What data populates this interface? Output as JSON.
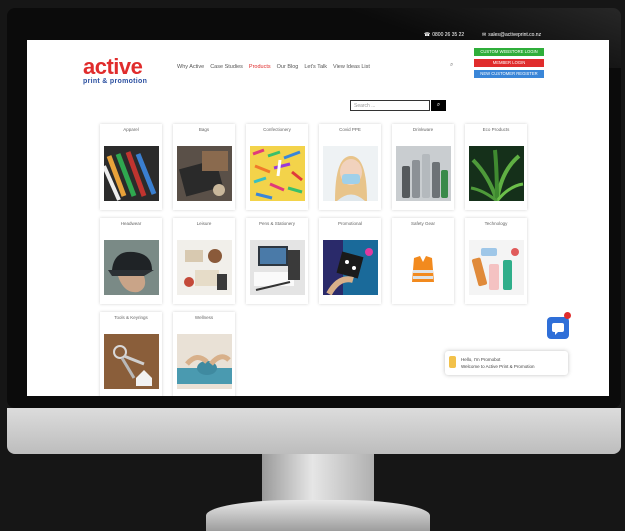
{
  "contact": {
    "phone": "0800 26 35 22",
    "email": "sales@activeprint.co.nz"
  },
  "logo": {
    "word": "active",
    "sub": "print & promotion"
  },
  "nav": [
    "Why Active",
    "Case Studies",
    "Products",
    "Our Blog",
    "Let's Talk",
    "View Ideas List"
  ],
  "nav_active": "Products",
  "buttons": {
    "custom": "CUSTOM WEBSTORE LOGIN",
    "member": "MEMBER LOGIN",
    "new_customer": "NEW CUSTOMER REGISTER"
  },
  "search": {
    "placeholder": "Search ..."
  },
  "categories": [
    "Apparel",
    "Bags",
    "Confectionery",
    "Covid PPE",
    "Drinkware",
    "Eco Products",
    "Headwear",
    "Leisure",
    "Pens & Stationery",
    "Promotional",
    "Safety Gear",
    "Technology",
    "Tools & Keyrings",
    "Wellness"
  ],
  "chat": {
    "line1": "Hello, I'm Promobot",
    "line2": "Welcome to Active Print & Promotion"
  },
  "colors": {
    "brand_red": "#e02c2c",
    "brand_blue": "#2a4fa0",
    "btn_green": "#2fae3a",
    "btn_blue": "#3a86d8"
  }
}
